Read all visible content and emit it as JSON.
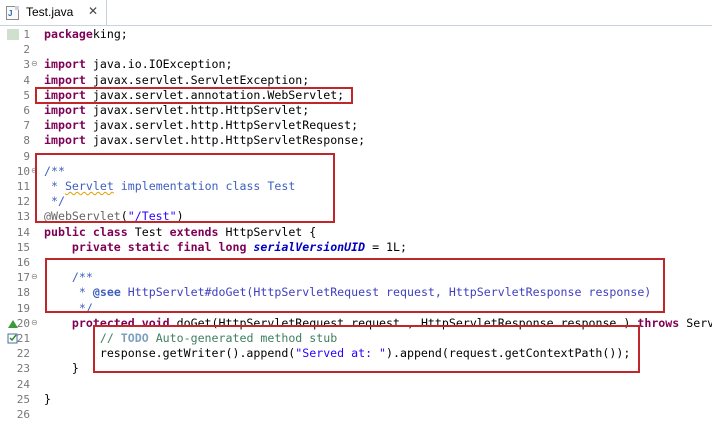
{
  "tab": {
    "title": "Test.java",
    "close_glyph": "✕"
  },
  "lines": [
    {
      "n": "1",
      "parts": [
        [
          "kw",
          "package"
        ],
        [
          "",
          "king;"
        ]
      ]
    },
    {
      "n": "2",
      "parts": []
    },
    {
      "n": "3",
      "fold": "⊖",
      "parts": [
        [
          "kw",
          "import"
        ],
        [
          "",
          " java.io.IOException;"
        ]
      ]
    },
    {
      "n": "4",
      "parts": [
        [
          "kw",
          "import"
        ],
        [
          "",
          " javax.servlet.ServletException;"
        ]
      ]
    },
    {
      "n": "5",
      "parts": [
        [
          "kw",
          "import"
        ],
        [
          "",
          " javax.servlet.annotation.WebServlet;"
        ]
      ]
    },
    {
      "n": "6",
      "parts": [
        [
          "kw",
          "import"
        ],
        [
          "",
          " javax.servlet.http.HttpServlet;"
        ]
      ]
    },
    {
      "n": "7",
      "parts": [
        [
          "kw",
          "import"
        ],
        [
          "",
          " javax.servlet.http.HttpServletRequest;"
        ]
      ]
    },
    {
      "n": "8",
      "parts": [
        [
          "kw",
          "import"
        ],
        [
          "",
          " javax.servlet.http.HttpServletResponse;"
        ]
      ]
    },
    {
      "n": "9",
      "parts": []
    },
    {
      "n": "10",
      "fold": "⊖",
      "parts": [
        [
          "jd",
          "/**"
        ]
      ]
    },
    {
      "n": "11",
      "parts": [
        [
          "jd",
          " * "
        ],
        [
          "jd sq",
          "Servlet"
        ],
        [
          "jd",
          " implementation class Test"
        ]
      ]
    },
    {
      "n": "12",
      "parts": [
        [
          "jd",
          " */"
        ]
      ]
    },
    {
      "n": "13",
      "parts": [
        [
          "annot",
          "@WebServlet"
        ],
        [
          "",
          "("
        ],
        [
          "str",
          "\"/Test\""
        ],
        [
          "",
          ")"
        ]
      ]
    },
    {
      "n": "14",
      "parts": [
        [
          "kw",
          "public class"
        ],
        [
          "",
          " Test "
        ],
        [
          "kw",
          "extends"
        ],
        [
          "",
          " HttpServlet {"
        ]
      ]
    },
    {
      "n": "15",
      "parts": [
        [
          "",
          "    "
        ],
        [
          "kw",
          "private static final long"
        ],
        [
          "",
          " "
        ],
        [
          "field",
          "serialVersionUID"
        ],
        [
          "",
          " = 1L;"
        ]
      ]
    },
    {
      "n": "16",
      "parts": []
    },
    {
      "n": "17",
      "fold": "⊖",
      "parts": [
        [
          "",
          "    "
        ],
        [
          "jd",
          "/**"
        ]
      ]
    },
    {
      "n": "18",
      "parts": [
        [
          "jd",
          "     * "
        ],
        [
          "jd b",
          "@see"
        ],
        [
          "link",
          " HttpServlet#doGet(HttpServletRequest request, HttpServletResponse response)"
        ]
      ]
    },
    {
      "n": "19",
      "parts": [
        [
          "jd",
          "     */"
        ]
      ]
    },
    {
      "n": "20",
      "fold": "⊖",
      "ann": "triangle",
      "parts": [
        [
          "",
          "    "
        ],
        [
          "kw",
          "protected void"
        ],
        [
          "",
          " doGet(HttpServletRequest "
        ],
        [
          "",
          "request"
        ],
        [
          "",
          " , HttpServletResponse "
        ],
        [
          "",
          "response"
        ],
        [
          "",
          " ) "
        ],
        [
          "kw",
          "throws"
        ],
        [
          "",
          " ServletException"
        ]
      ]
    },
    {
      "n": "21",
      "ann": "todo",
      "parts": [
        [
          "",
          "        "
        ],
        [
          "cm",
          "// "
        ],
        [
          "todo",
          "TODO"
        ],
        [
          "cm",
          " Auto-generated method stub"
        ]
      ]
    },
    {
      "n": "22",
      "parts": [
        [
          "",
          "        response.getWriter().append("
        ],
        [
          "str",
          "\"Served at: \""
        ],
        [
          "",
          ").append(request.getContextPath());"
        ]
      ]
    },
    {
      "n": "23",
      "parts": [
        [
          "",
          "    }"
        ]
      ]
    },
    {
      "n": "24",
      "parts": []
    },
    {
      "n": "25",
      "parts": [
        [
          "",
          "}"
        ]
      ]
    },
    {
      "n": "26",
      "parts": []
    }
  ],
  "colors": {
    "keyword": "#7f0055",
    "string": "#2a00ff",
    "javadoc": "#3f5fbf",
    "comment": "#3f7f5f",
    "annotation": "#646464",
    "highlight_box": "#c0262c"
  }
}
